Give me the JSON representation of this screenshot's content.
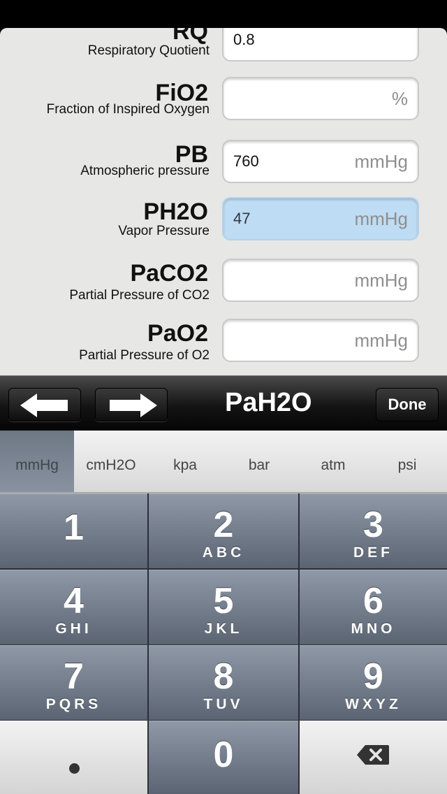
{
  "fields": [
    {
      "key": "rq",
      "label": "RQ",
      "sublabel": "Respiratory Quotient",
      "value": "0.8",
      "unit": ""
    },
    {
      "key": "fio2",
      "label": "FiO2",
      "sublabel": "Fraction of Inspired Oxygen",
      "value": "",
      "unit": "%"
    },
    {
      "key": "pb",
      "label": "PB",
      "sublabel": "Atmospheric pressure",
      "value": "760",
      "unit": "mmHg"
    },
    {
      "key": "ph2o",
      "label": "PH2O",
      "sublabel": "Vapor Pressure",
      "value": "47",
      "unit": "mmHg",
      "active": true
    },
    {
      "key": "paco2",
      "label": "PaCO2",
      "sublabel": "Partial Pressure of CO2",
      "value": "",
      "unit": "mmHg"
    },
    {
      "key": "pao2",
      "label": "PaO2",
      "sublabel": "Partial Pressure of O2",
      "value": "",
      "unit": "mmHg"
    }
  ],
  "toolbar": {
    "title": "PaH2O",
    "done_label": "Done",
    "prev_icon": "arrow-left-icon",
    "next_icon": "arrow-right-icon"
  },
  "units": {
    "options": [
      "mmHg",
      "cmH2O",
      "kpa",
      "bar",
      "atm",
      "psi"
    ],
    "selected": "mmHg"
  },
  "keypad": {
    "keys": [
      {
        "num": "1",
        "letters": ""
      },
      {
        "num": "2",
        "letters": "ABC"
      },
      {
        "num": "3",
        "letters": "DEF"
      },
      {
        "num": "4",
        "letters": "GHI"
      },
      {
        "num": "5",
        "letters": "JKL"
      },
      {
        "num": "6",
        "letters": "MNO"
      },
      {
        "num": "7",
        "letters": "PQRS"
      },
      {
        "num": "8",
        "letters": "TUV"
      },
      {
        "num": "9",
        "letters": "WXYZ"
      },
      {
        "num": "0",
        "letters": ""
      }
    ],
    "decimal_icon": "decimal-point-icon",
    "backspace_icon": "backspace-icon"
  },
  "colors": {
    "active_field": "#bedcf3",
    "toolbar": "#141414",
    "key": "#5b6472"
  }
}
